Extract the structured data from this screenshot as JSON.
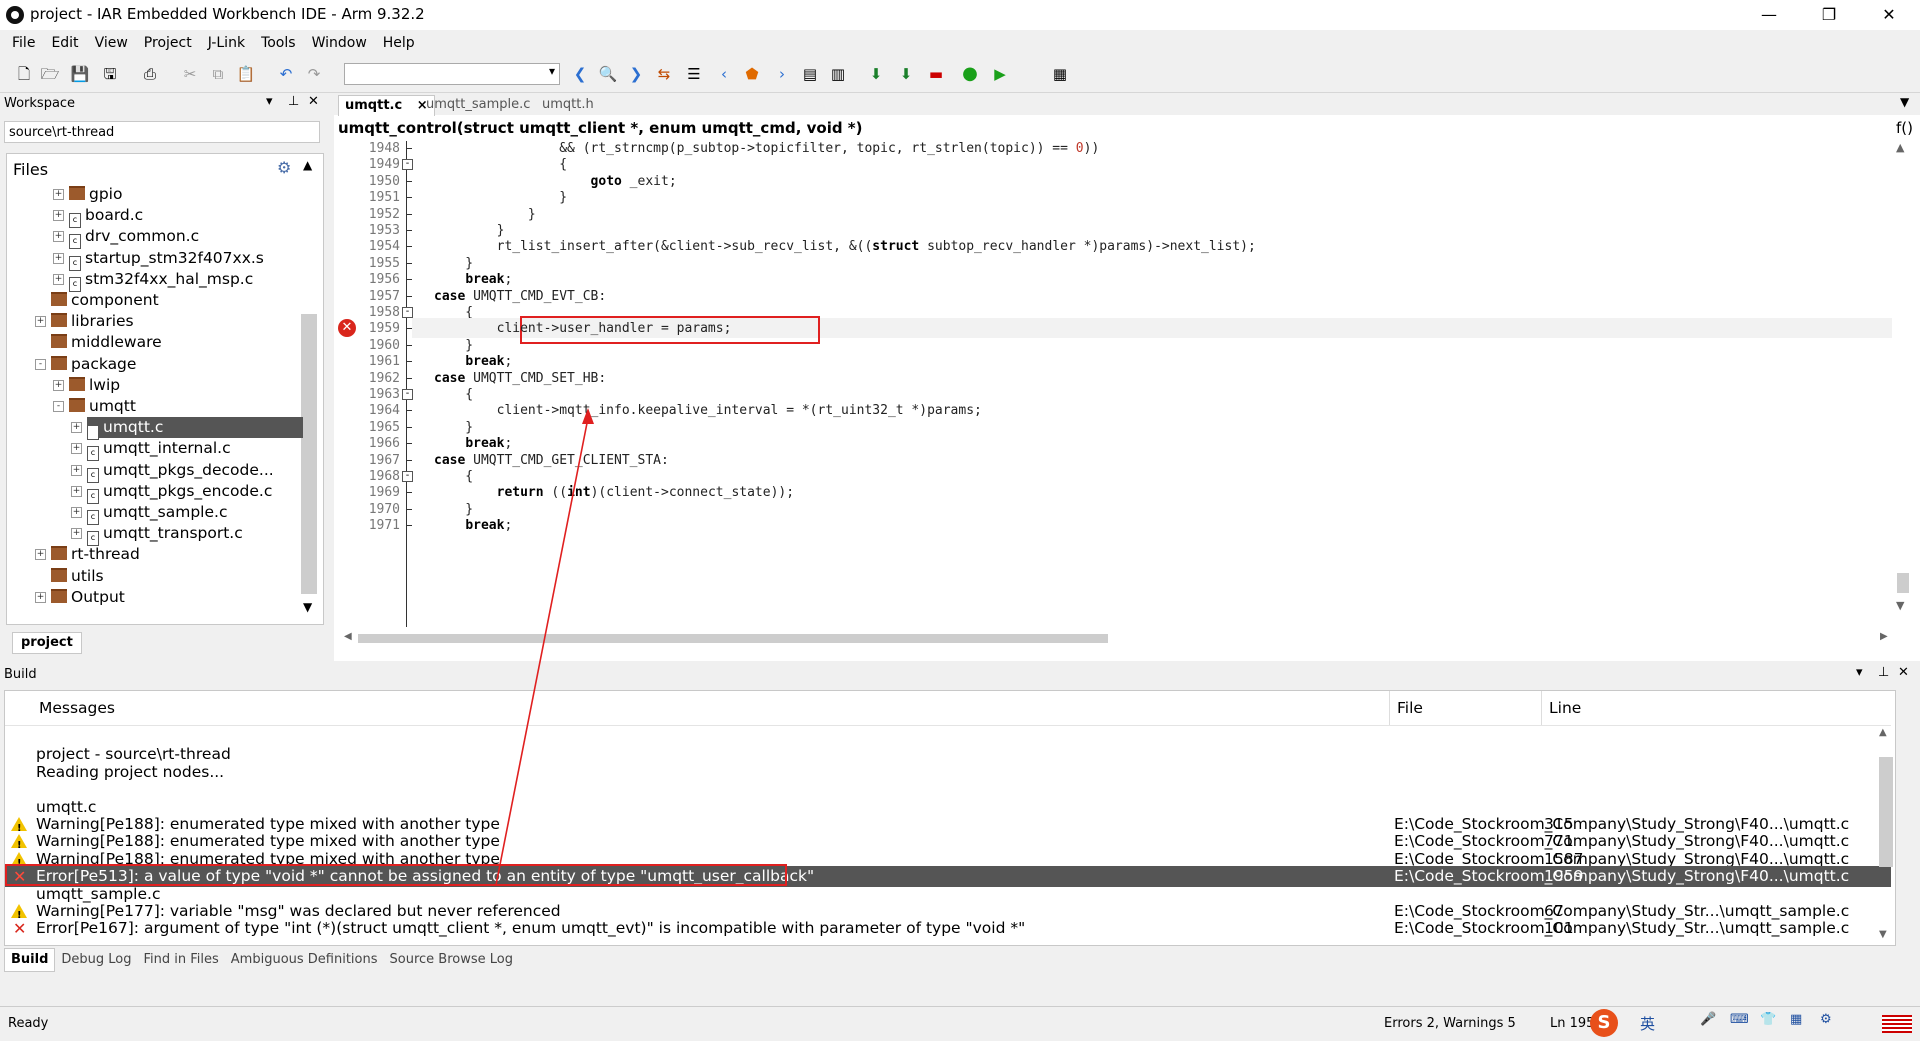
{
  "window": {
    "title": "project - IAR Embedded Workbench IDE - Arm 9.32.2"
  },
  "menu": [
    "File",
    "Edit",
    "View",
    "Project",
    "J-Link",
    "Tools",
    "Window",
    "Help"
  ],
  "workspace": {
    "header": "Workspace",
    "config": "source\\rt-thread",
    "files_label": "Files",
    "footer_tab": "project",
    "tree": [
      {
        "label": "gpio",
        "kind": "folder",
        "depth": 2,
        "exp": "+"
      },
      {
        "label": "board.c",
        "kind": "file",
        "depth": 2,
        "exp": "+"
      },
      {
        "label": "drv_common.c",
        "kind": "file",
        "depth": 2,
        "exp": "+"
      },
      {
        "label": "startup_stm32f407xx.s",
        "kind": "file",
        "depth": 2,
        "exp": "+"
      },
      {
        "label": "stm32f4xx_hal_msp.c",
        "kind": "file",
        "depth": 2,
        "exp": "+"
      },
      {
        "label": "component",
        "kind": "folder",
        "depth": 1,
        "exp": ""
      },
      {
        "label": "libraries",
        "kind": "folder",
        "depth": 1,
        "exp": "+"
      },
      {
        "label": "middleware",
        "kind": "folder",
        "depth": 1,
        "exp": ""
      },
      {
        "label": "package",
        "kind": "folder",
        "depth": 1,
        "exp": "-"
      },
      {
        "label": "lwip",
        "kind": "folder",
        "depth": 2,
        "exp": "+"
      },
      {
        "label": "umqtt",
        "kind": "folder",
        "depth": 2,
        "exp": "-"
      },
      {
        "label": "umqtt.c",
        "kind": "file",
        "depth": 3,
        "exp": "+",
        "selected": true
      },
      {
        "label": "umqtt_internal.c",
        "kind": "file",
        "depth": 3,
        "exp": "+"
      },
      {
        "label": "umqtt_pkgs_decode...",
        "kind": "file",
        "depth": 3,
        "exp": "+"
      },
      {
        "label": "umqtt_pkgs_encode.c",
        "kind": "file",
        "depth": 3,
        "exp": "+"
      },
      {
        "label": "umqtt_sample.c",
        "kind": "file",
        "depth": 3,
        "exp": "+"
      },
      {
        "label": "umqtt_transport.c",
        "kind": "file",
        "depth": 3,
        "exp": "+"
      },
      {
        "label": "rt-thread",
        "kind": "folder",
        "depth": 1,
        "exp": "+"
      },
      {
        "label": "utils",
        "kind": "folder",
        "depth": 1,
        "exp": ""
      },
      {
        "label": "Output",
        "kind": "folder",
        "depth": 1,
        "exp": "+"
      }
    ]
  },
  "editor": {
    "tabs": [
      "umqtt.c",
      "umqtt_sample.c",
      "umqtt.h"
    ],
    "active_tab_close": "×",
    "function_bar": "umqtt_control(struct umqtt_client *, enum umqtt_cmd, void *)",
    "func_button": "f()",
    "lines": [
      {
        "n": "1948",
        "code": "                && (rt_strncmp(p_subtop->topicfilter, topic, rt_strlen(topic)) == 0))",
        "fold": ""
      },
      {
        "n": "1949",
        "code": "                {",
        "fold": "-"
      },
      {
        "n": "1950",
        "code": "                    goto _exit;",
        "fold": ""
      },
      {
        "n": "1951",
        "code": "                }",
        "fold": ""
      },
      {
        "n": "1952",
        "code": "            }",
        "fold": ""
      },
      {
        "n": "1953",
        "code": "        }",
        "fold": ""
      },
      {
        "n": "1954",
        "code": "        rt_list_insert_after(&client->sub_recv_list, &((struct subtop_recv_handler *)params)->next_list);",
        "fold": ""
      },
      {
        "n": "1955",
        "code": "    }",
        "fold": ""
      },
      {
        "n": "1956",
        "code": "    break;",
        "fold": ""
      },
      {
        "n": "1957",
        "code": "case UMQTT_CMD_EVT_CB:",
        "fold": ""
      },
      {
        "n": "1958",
        "code": "    {",
        "fold": "-"
      },
      {
        "n": "1959",
        "code": "        client->user_handler = params;",
        "fold": "",
        "error": true
      },
      {
        "n": "1960",
        "code": "    }",
        "fold": ""
      },
      {
        "n": "1961",
        "code": "    break;",
        "fold": ""
      },
      {
        "n": "1962",
        "code": "case UMQTT_CMD_SET_HB:",
        "fold": ""
      },
      {
        "n": "1963",
        "code": "    {",
        "fold": "-"
      },
      {
        "n": "1964",
        "code": "        client->mqtt_info.keepalive_interval = *(rt_uint32_t *)params;",
        "fold": ""
      },
      {
        "n": "1965",
        "code": "    }",
        "fold": ""
      },
      {
        "n": "1966",
        "code": "    break;",
        "fold": ""
      },
      {
        "n": "1967",
        "code": "case UMQTT_CMD_GET_CLIENT_STA:",
        "fold": ""
      },
      {
        "n": "1968",
        "code": "    {",
        "fold": "-"
      },
      {
        "n": "1969",
        "code": "        return ((int)(client->connect_state));",
        "fold": ""
      },
      {
        "n": "1970",
        "code": "    }",
        "fold": ""
      },
      {
        "n": "1971",
        "code": "    break;",
        "fold": ""
      }
    ]
  },
  "build": {
    "header": "Build",
    "columns": {
      "messages": "Messages",
      "file": "File",
      "line": "Line"
    },
    "rows": [
      {
        "type": "blank",
        "msg": "",
        "file": "",
        "line": ""
      },
      {
        "type": "text",
        "msg": "project - source\\rt-thread",
        "file": "",
        "line": ""
      },
      {
        "type": "text",
        "msg": "Reading project nodes...",
        "file": "",
        "line": ""
      },
      {
        "type": "blank",
        "msg": "",
        "file": "",
        "line": ""
      },
      {
        "type": "text",
        "msg": "umqtt.c",
        "file": "",
        "line": ""
      },
      {
        "type": "warning",
        "msg": "Warning[Pe188]: enumerated type mixed with another type",
        "file": "E:\\Code_Stockroom_Company\\Study_Strong\\F40...\\umqtt.c",
        "line": "315"
      },
      {
        "type": "warning",
        "msg": "Warning[Pe188]: enumerated type mixed with another type",
        "file": "E:\\Code_Stockroom_Company\\Study_Strong\\F40...\\umqtt.c",
        "line": "771"
      },
      {
        "type": "warning",
        "msg": "Warning[Pe188]: enumerated type mixed with another type",
        "file": "E:\\Code_Stockroom_Company\\Study_Strong\\F40...\\umqtt.c",
        "line": "1587"
      },
      {
        "type": "error",
        "msg": "Error[Pe513]: a value of type \"void *\" cannot be assigned to an entity of type \"umqtt_user_callback\"",
        "file": "E:\\Code_Stockroom_Company\\Study_Strong\\F40...\\umqtt.c",
        "line": "1959",
        "selected": true
      },
      {
        "type": "text",
        "msg": "umqtt_sample.c",
        "file": "",
        "line": ""
      },
      {
        "type": "warning",
        "msg": "Warning[Pe177]: variable \"msg\" was declared but never referenced",
        "file": "E:\\Code_Stockroom_Company\\Study_Str...\\umqtt_sample.c",
        "line": "67"
      },
      {
        "type": "error",
        "msg": "Error[Pe167]: argument of type \"int (*)(struct umqtt_client *, enum umqtt_evt)\" is incompatible with parameter of type \"void *\"",
        "file": "E:\\Code_Stockroom_Company\\Study_Str...\\umqtt_sample.c",
        "line": "101"
      }
    ],
    "tabs": [
      "Build",
      "Debug Log",
      "Find in Files",
      "Ambiguous Definitions",
      "Source Browse Log"
    ]
  },
  "status": {
    "left": "Ready",
    "counts": "Errors 2, Warnings 5",
    "position": "Ln 1959",
    "ime": "英"
  }
}
